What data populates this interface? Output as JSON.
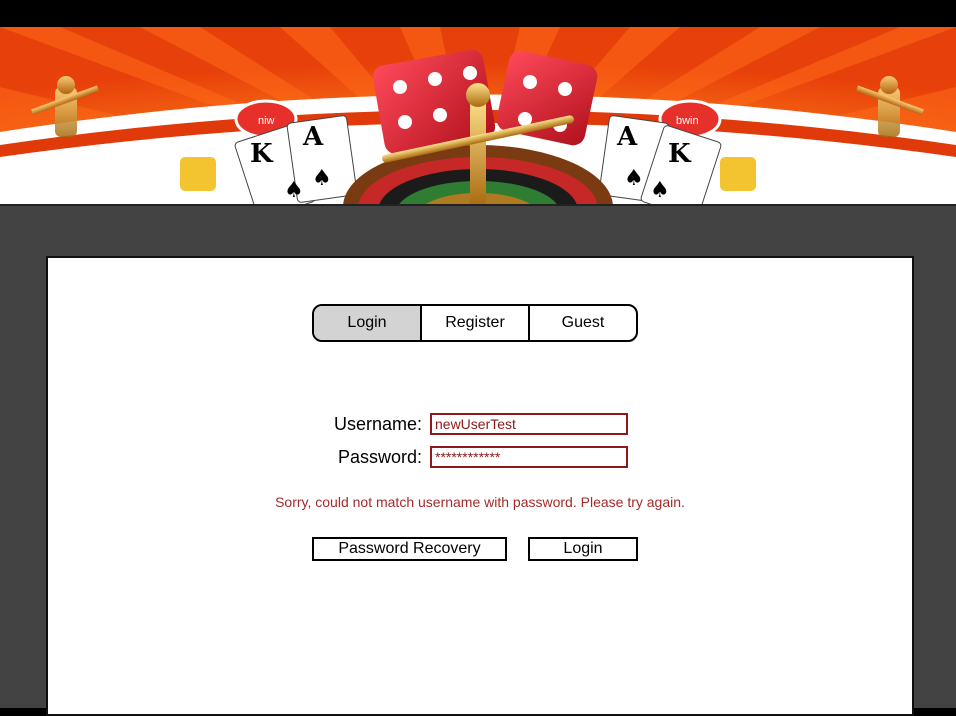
{
  "tabs": [
    {
      "label": "Login",
      "active": true
    },
    {
      "label": "Register",
      "active": false
    },
    {
      "label": "Guest",
      "active": false
    }
  ],
  "form": {
    "username_label": "Username:",
    "username_value": "newUserTest",
    "password_label": "Password:",
    "password_value": "************",
    "error_message": "Sorry, could not match username with password. Please try again."
  },
  "buttons": {
    "recovery_label": "Password Recovery",
    "login_label": "Login"
  },
  "banner": {
    "card_rank_left": "K",
    "card_rank_left2": "A",
    "card_rank_right": "A",
    "card_rank_right2": "K",
    "chip_left": "niw",
    "chip_right": "bwin"
  },
  "colors": {
    "banner_orange": "#f04a0c",
    "panel_bg": "#434343",
    "error_red": "#a52a2a",
    "field_border": "#8b1a1a",
    "active_tab": "#d3d3d3"
  }
}
